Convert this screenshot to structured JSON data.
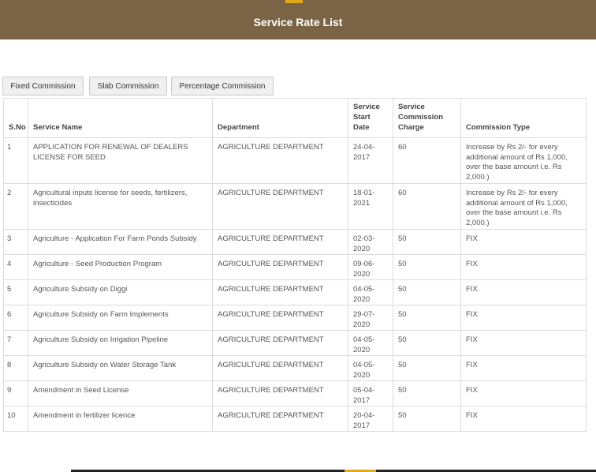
{
  "header": {
    "title": "Service Rate List"
  },
  "tabs": [
    {
      "label": "Fixed Commission"
    },
    {
      "label": "Slab Commission"
    },
    {
      "label": "Percentage Commission"
    }
  ],
  "table": {
    "headers": {
      "sno": "S.No",
      "service_name": "Service Name",
      "department": "Department",
      "start_date": "Service Start Date",
      "commission_charge": "Service Commission Charge",
      "commission_type": "Commission Type"
    },
    "rows": [
      {
        "sno": "1",
        "service_name": "APPLICATION FOR RENEWAL OF DEALERS LICENSE FOR SEED",
        "department": "AGRICULTURE DEPARTMENT",
        "start_date": "24-04-2017",
        "charge": "60",
        "type": "Increase by Rs 2/- for every additional amount of Rs 1,000, over the base amount i.e. Rs 2,000.)"
      },
      {
        "sno": "2",
        "service_name": "Agricultural inputs license for seeds, fertilizers, insecticides",
        "department": "AGRICULTURE DEPARTMENT",
        "start_date": "18-01-2021",
        "charge": "60",
        "type": "Increase by Rs 2/- for every additional amount of Rs 1,000, over the base amount i.e. Rs 2,000.)"
      },
      {
        "sno": "3",
        "service_name": "Agriculture - Application For Farm Ponds Subsidy",
        "department": "AGRICULTURE DEPARTMENT",
        "start_date": "02-03-2020",
        "charge": "50",
        "type": "FIX"
      },
      {
        "sno": "4",
        "service_name": "Agriculture - Seed Production Program",
        "department": "AGRICULTURE DEPARTMENT",
        "start_date": "09-06-2020",
        "charge": "50",
        "type": "FIX"
      },
      {
        "sno": "5",
        "service_name": "Agriculture Subsidy on Diggi",
        "department": "AGRICULTURE DEPARTMENT",
        "start_date": "04-05-2020",
        "charge": "50",
        "type": "FIX"
      },
      {
        "sno": "6",
        "service_name": "Agriculture Subsidy on Farm Implements",
        "department": "AGRICULTURE DEPARTMENT",
        "start_date": "29-07-2020",
        "charge": "50",
        "type": "FIX"
      },
      {
        "sno": "7",
        "service_name": "Agriculture Subsidy on Irrigation Pipeline",
        "department": "AGRICULTURE DEPARTMENT",
        "start_date": "04-05-2020",
        "charge": "50",
        "type": "FIX"
      },
      {
        "sno": "8",
        "service_name": "Agriculture Subsidy on Water Storage Tank",
        "department": "AGRICULTURE DEPARTMENT",
        "start_date": "04-05-2020",
        "charge": "50",
        "type": "FIX"
      },
      {
        "sno": "9",
        "service_name": "Amendment in Seed License",
        "department": "AGRICULTURE DEPARTMENT",
        "start_date": "05-04-2017",
        "charge": "50",
        "type": "FIX"
      },
      {
        "sno": "10",
        "service_name": "Amendment in fertilizer licence",
        "department": "AGRICULTURE DEPARTMENT",
        "start_date": "20-04-2017",
        "charge": "50",
        "type": "FIX"
      }
    ]
  },
  "colors": {
    "header_bg": "#7a6445",
    "accent": "#e2a91b",
    "border": "#dcdcdc"
  }
}
